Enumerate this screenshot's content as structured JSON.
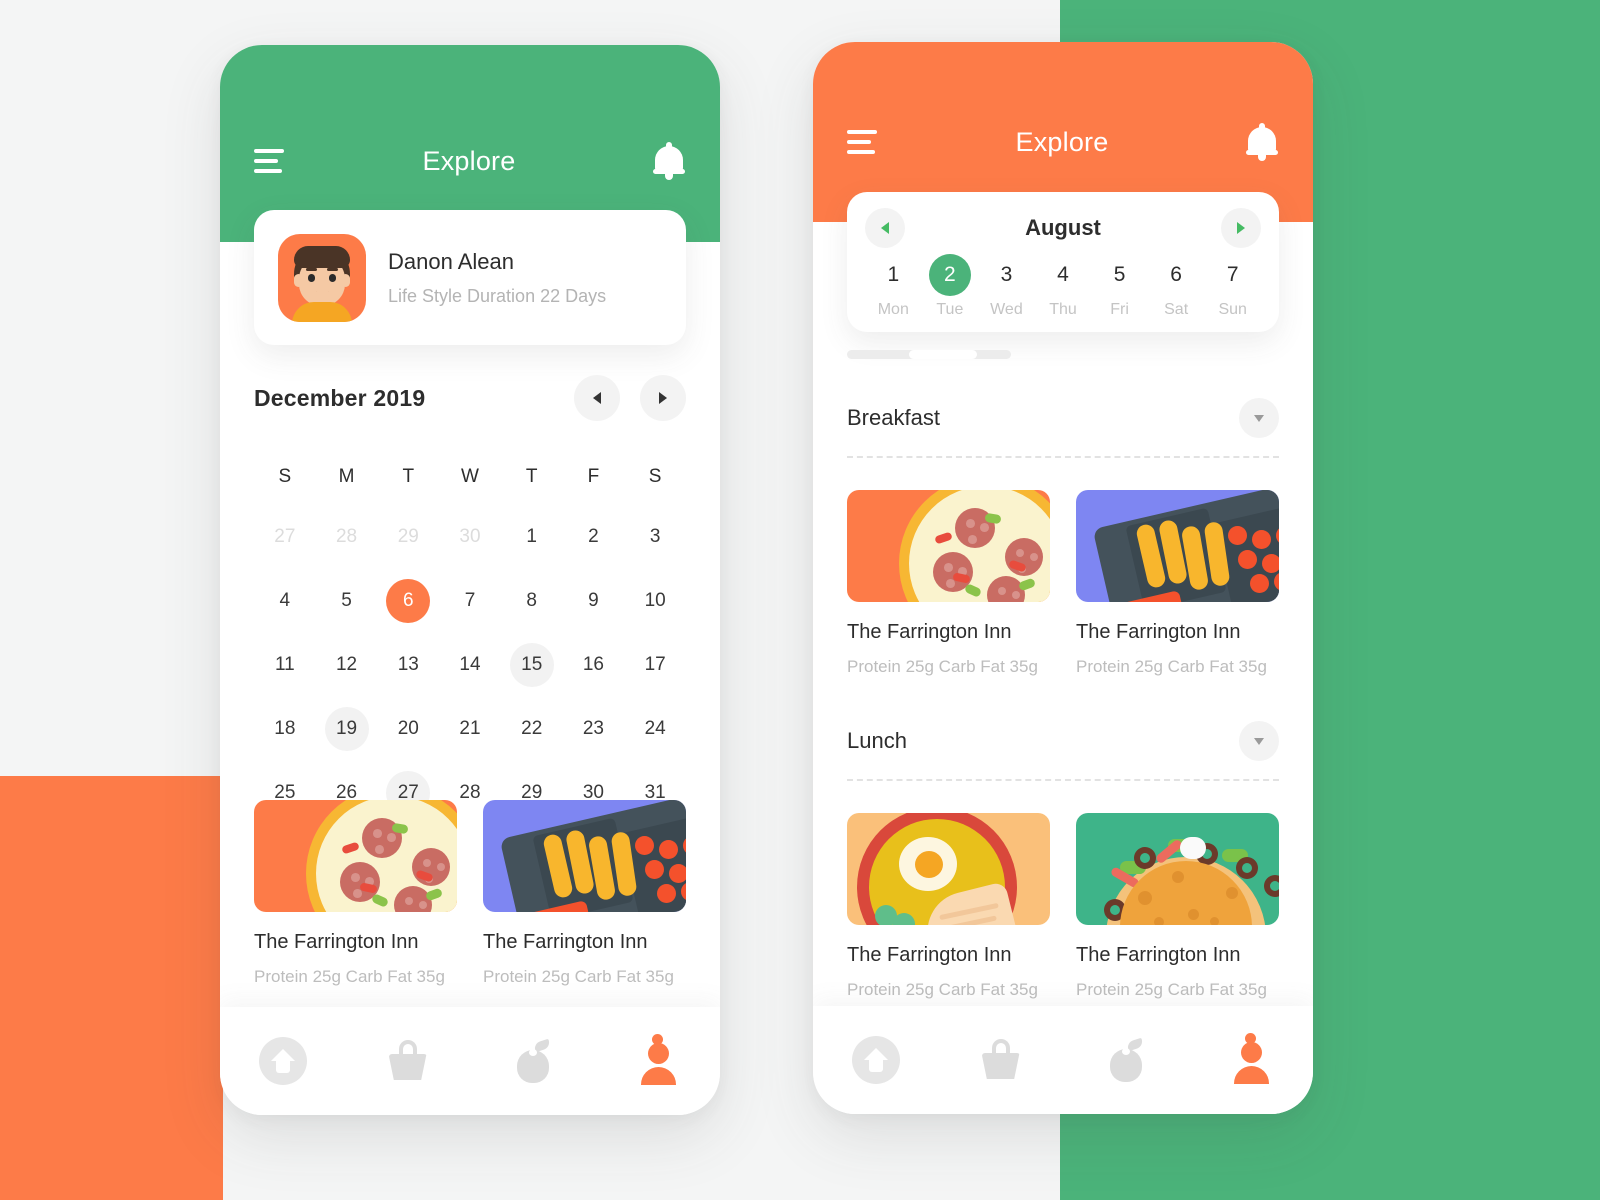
{
  "colors": {
    "green": "#4BB37A",
    "orange": "#FD7B48",
    "page_bg": "#f4f5f5",
    "muted_text": "#bdbdbd"
  },
  "left_phone": {
    "header": {
      "menu_icon": "hamburger-icon",
      "title": "Explore",
      "bell_icon": "bell-icon"
    },
    "profile": {
      "avatar_icon": "boy-avatar",
      "name": "Danon Alean",
      "subtitle": "Life Style Duration 22 Days"
    },
    "calendar": {
      "title": "December 2019",
      "prev_icon": "chevron-left-icon",
      "next_icon": "chevron-right-icon",
      "weekday_labels": [
        "S",
        "M",
        "T",
        "W",
        "T",
        "F",
        "S"
      ],
      "days": [
        {
          "n": "27",
          "state": "muted"
        },
        {
          "n": "28",
          "state": "muted"
        },
        {
          "n": "29",
          "state": "muted"
        },
        {
          "n": "30",
          "state": "muted"
        },
        {
          "n": "1",
          "state": "normal"
        },
        {
          "n": "2",
          "state": "normal"
        },
        {
          "n": "3",
          "state": "normal"
        },
        {
          "n": "4",
          "state": "normal"
        },
        {
          "n": "5",
          "state": "normal"
        },
        {
          "n": "6",
          "state": "selected"
        },
        {
          "n": "7",
          "state": "normal"
        },
        {
          "n": "8",
          "state": "normal"
        },
        {
          "n": "9",
          "state": "normal"
        },
        {
          "n": "10",
          "state": "normal"
        },
        {
          "n": "11",
          "state": "normal"
        },
        {
          "n": "12",
          "state": "normal"
        },
        {
          "n": "13",
          "state": "normal"
        },
        {
          "n": "14",
          "state": "normal"
        },
        {
          "n": "15",
          "state": "dim"
        },
        {
          "n": "16",
          "state": "normal"
        },
        {
          "n": "17",
          "state": "normal"
        },
        {
          "n": "18",
          "state": "normal"
        },
        {
          "n": "19",
          "state": "dim"
        },
        {
          "n": "20",
          "state": "normal"
        },
        {
          "n": "21",
          "state": "normal"
        },
        {
          "n": "22",
          "state": "normal"
        },
        {
          "n": "23",
          "state": "normal"
        },
        {
          "n": "24",
          "state": "normal"
        },
        {
          "n": "25",
          "state": "normal"
        },
        {
          "n": "26",
          "state": "normal"
        },
        {
          "n": "27",
          "state": "dim"
        },
        {
          "n": "28",
          "state": "normal"
        },
        {
          "n": "29",
          "state": "normal"
        },
        {
          "n": "30",
          "state": "normal"
        },
        {
          "n": "31",
          "state": "normal"
        }
      ]
    },
    "foods": [
      {
        "name": "The Farrington Inn",
        "meta": "Protein 25g Carb Fat 35g",
        "art": "pizza"
      },
      {
        "name": "The Farrington Inn",
        "meta": "Protein 25g Carb Fat 35g",
        "art": "bento"
      }
    ],
    "nav": [
      {
        "icon": "home-icon",
        "active": false
      },
      {
        "icon": "basket-icon",
        "active": false
      },
      {
        "icon": "apple-icon",
        "active": false
      },
      {
        "icon": "user-icon",
        "active": true
      }
    ]
  },
  "right_phone": {
    "header": {
      "menu_icon": "hamburger-icon",
      "title": "Explore",
      "bell_icon": "bell-icon"
    },
    "week": {
      "month": "August",
      "prev_icon": "chevron-left-icon",
      "next_icon": "chevron-right-icon",
      "days": [
        {
          "num": "1",
          "label": "Mon",
          "active": false
        },
        {
          "num": "2",
          "label": "Tue",
          "active": true
        },
        {
          "num": "3",
          "label": "Wed",
          "active": false
        },
        {
          "num": "4",
          "label": "Thu",
          "active": false
        },
        {
          "num": "5",
          "label": "Fri",
          "active": false
        },
        {
          "num": "6",
          "label": "Sat",
          "active": false
        },
        {
          "num": "7",
          "label": "Sun",
          "active": false
        }
      ]
    },
    "meals": [
      {
        "title": "Breakfast",
        "collapse_icon": "chevron-down-icon",
        "foods": [
          {
            "name": "The Farrington Inn",
            "meta": "Protein 25g Carb Fat 35g",
            "art": "pizza"
          },
          {
            "name": "The Farrington Inn",
            "meta": "Protein 25g Carb Fat 35g",
            "art": "bento"
          }
        ]
      },
      {
        "title": "Lunch",
        "collapse_icon": "chevron-down-icon",
        "foods": [
          {
            "name": "The Farrington Inn",
            "meta": "Protein 25g Carb Fat 35g",
            "art": "ramen"
          },
          {
            "name": "The Farrington Inn",
            "meta": "Protein 25g Carb Fat 35g",
            "art": "taco"
          }
        ]
      }
    ],
    "nav": [
      {
        "icon": "home-icon",
        "active": false
      },
      {
        "icon": "basket-icon",
        "active": false
      },
      {
        "icon": "apple-icon",
        "active": false
      },
      {
        "icon": "user-icon",
        "active": true
      }
    ]
  }
}
